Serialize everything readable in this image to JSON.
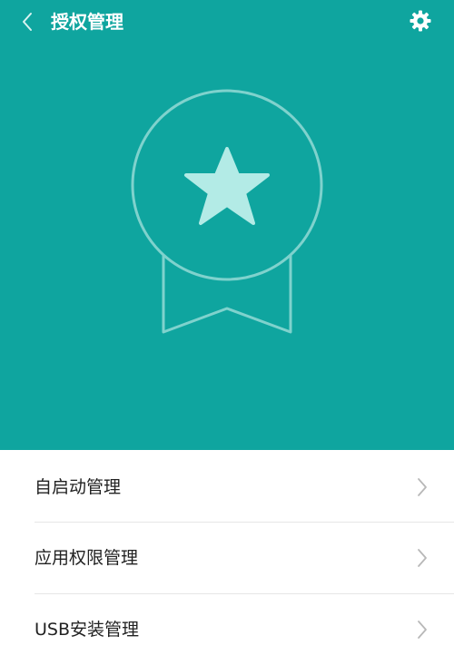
{
  "header": {
    "title": "授权管理",
    "back_icon": "chevron-left-icon",
    "settings_icon": "gear-icon"
  },
  "hero": {
    "background_color": "#0fa59f",
    "illustration_icon": "award-badge-star-icon"
  },
  "menu": {
    "items": [
      {
        "label": "自启动管理",
        "icon": "chevron-right-icon"
      },
      {
        "label": "应用权限管理",
        "icon": "chevron-right-icon"
      },
      {
        "label": "USB安装管理",
        "icon": "chevron-right-icon"
      }
    ]
  }
}
